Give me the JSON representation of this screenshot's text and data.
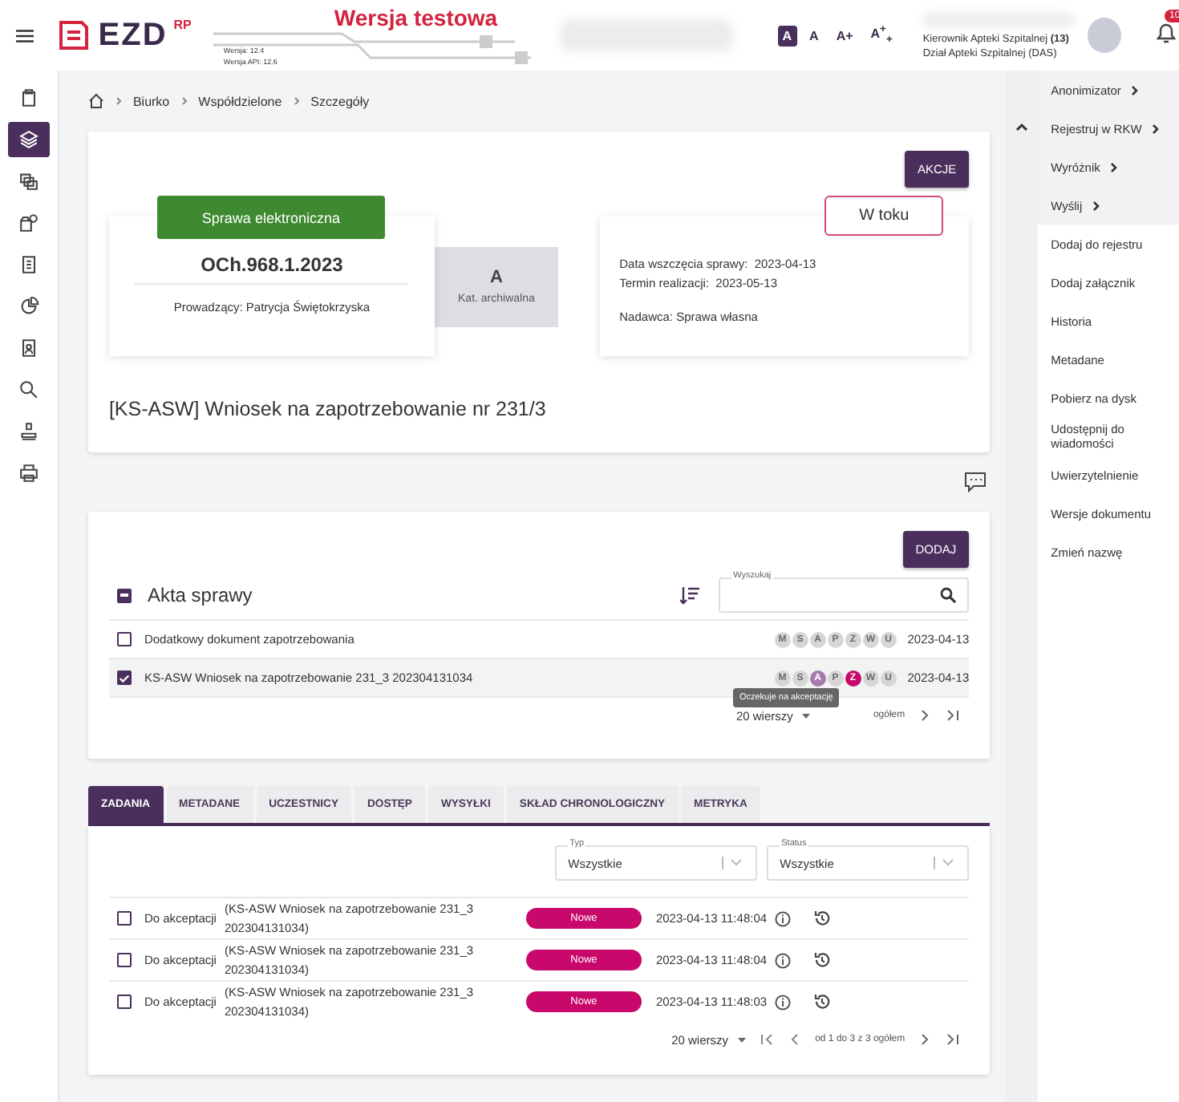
{
  "header": {
    "logo_text": "EZD",
    "logo_sup": "RP",
    "test_label": "Wersja testowa",
    "version": "Wersja: 12.4",
    "api_version": "Wersja API: 12.6",
    "font_sizes": [
      {
        "label": "A",
        "selected": true
      },
      {
        "label": "A",
        "selected": false
      },
      {
        "label": "A+",
        "selected": false
      },
      {
        "label": "A$^{+}$$_{+}$",
        "selected": false
      }
    ],
    "user_role": "Kierownik Apteki Szpitalnej **(13)**",
    "department": "Dział Apteki Szpitalnej (DAS)",
    "notifications": "10"
  },
  "sidebar": {
    "items": [
      {
        "selected": false
      },
      {
        "selected": true
      },
      {
        "selected": false
      },
      {
        "selected": false
      },
      {
        "selected": false
      },
      {
        "selected": false
      },
      {
        "selected": false
      },
      {
        "selected": false
      },
      {
        "selected": false
      },
      {
        "selected": false
      }
    ]
  },
  "breadcrumb": [
    "Biurko",
    "Współdzielone",
    "Szczegóły"
  ],
  "case": {
    "actions_button": "AKCJE",
    "type_badge": "Sprawa elektroniczna",
    "number": "OCh.968.1.2023",
    "manager": "Prowadzący: Patrycja Świętokrzyska",
    "archive_category": "A",
    "archive_label": "Kat. archiwalna",
    "status": "W toku",
    "details": [
      "Data wszczęcia sprawy:  2023-04-13",
      "Termin realizacji:  2023-05-13"
    ],
    "sender": "Nadawca: Sprawa własna",
    "title": "[KS-ASW] Wniosek na zapotrzebowanie nr 231/3"
  },
  "files": {
    "add_button": "DODAJ",
    "title": "Akta sprawy",
    "select_all_partial": true,
    "search": {
      "label": "Wyszukaj"
    },
    "rows": [
      {
        "name": "Dodatkowy dokument zapotrzebowania",
        "checked": false,
        "date": "2023-04-13",
        "flags": [
          {
            "letter": "M",
            "color": "#d6d6d6"
          },
          {
            "letter": "S",
            "color": "#d6d6d6"
          },
          {
            "letter": "A",
            "color": "#d6d6d6"
          },
          {
            "letter": "P",
            "color": "#d6d6d6"
          },
          {
            "letter": "Z",
            "color": "#d6d6d6"
          },
          {
            "letter": "W",
            "color": "#d6d6d6"
          },
          {
            "letter": "U",
            "color": "#d6d6d6"
          }
        ]
      },
      {
        "name": "KS-ASW Wniosek na zapotrzebowanie 231_3 202304131034",
        "checked": true,
        "date": "2023-04-13",
        "flags": [
          {
            "letter": "M",
            "color": "#d6d6d6"
          },
          {
            "letter": "S",
            "color": "#d6d6d6"
          },
          {
            "letter": "A",
            "color": "#a57bb0"
          },
          {
            "letter": "P",
            "color": "#d6d6d6"
          },
          {
            "letter": "Z",
            "color": "#c8086a"
          },
          {
            "letter": "W",
            "color": "#d6d6d6"
          },
          {
            "letter": "U",
            "color": "#d6d6d6"
          }
        ]
      }
    ],
    "rows_per_page": "20 wierszy",
    "page_info": "ogółem",
    "tooltip": "Oczekuje na akceptację"
  },
  "tabs": [
    {
      "label": "ZADANIA",
      "selected": true
    },
    {
      "label": "METADANE",
      "selected": false
    },
    {
      "label": "UCZESTNICY",
      "selected": false
    },
    {
      "label": "DOSTĘP",
      "selected": false
    },
    {
      "label": "WYSYŁKI",
      "selected": false
    },
    {
      "label": "SKŁAD CHRONOLOGICZNY",
      "selected": false
    },
    {
      "label": "METRYKA",
      "selected": false
    }
  ],
  "tasks": {
    "filters": [
      {
        "label": "Typ",
        "value": "Wszystkie"
      },
      {
        "label": "Status",
        "value": "Wszystkie"
      }
    ],
    "rows": [
      {
        "checked": false,
        "type": "Do akceptacji",
        "document": "(KS-ASW Wniosek na zapotrzebowanie 231_3 202304131034)",
        "status": "Nowe",
        "time": "2023-04-13 11:48:04"
      },
      {
        "checked": false,
        "type": "Do akceptacji",
        "document": "(KS-ASW Wniosek na zapotrzebowanie 231_3 202304131034)",
        "status": "Nowe",
        "time": "2023-04-13 11:48:04"
      },
      {
        "checked": false,
        "type": "Do akceptacji",
        "document": "(KS-ASW Wniosek na zapotrzebowanie 231_3 202304131034)",
        "status": "Nowe",
        "time": "2023-04-13 11:48:03"
      }
    ],
    "rows_per_page": "20 wierszy",
    "page_info": "od 1 do 3 z 3 ogółem"
  },
  "right_menu": [
    {
      "label": "Anonimizator",
      "submenu": true
    },
    {
      "label": "Rejestruj w RKW",
      "submenu": true
    },
    {
      "label": "Wyróżnik",
      "submenu": true
    },
    {
      "label": "Wyślij",
      "submenu": true
    },
    {
      "label": "Dodaj do rejestru",
      "submenu": false
    },
    {
      "label": "Dodaj załącznik",
      "submenu": false
    },
    {
      "label": "Historia",
      "submenu": false
    },
    {
      "label": "Metadane",
      "submenu": false
    },
    {
      "label": "Pobierz na dysk",
      "submenu": false
    },
    {
      "label": "Udostępnij do wiadomości",
      "submenu": false
    },
    {
      "label": "Uwierzytelnienie",
      "submenu": false
    },
    {
      "label": "Wersje dokumentu",
      "submenu": false
    },
    {
      "label": "Zmień nazwę",
      "submenu": false
    }
  ]
}
